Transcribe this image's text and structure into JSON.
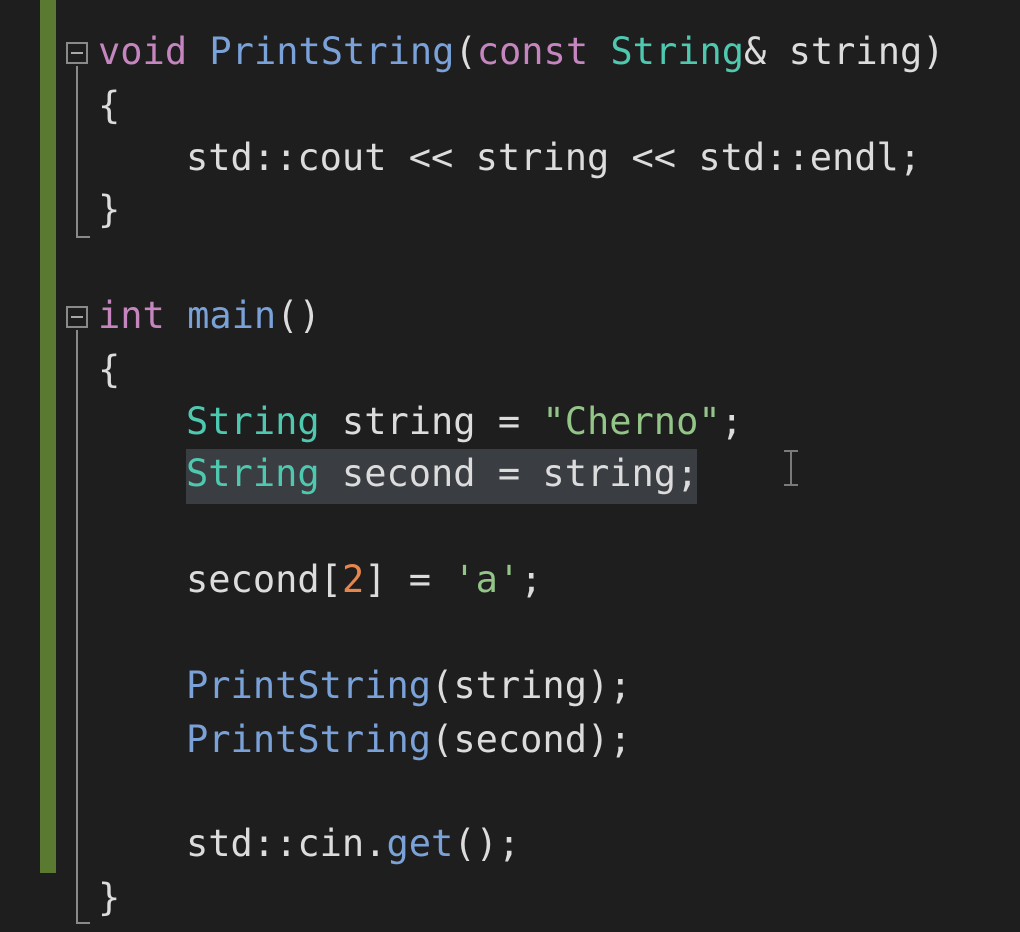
{
  "code": {
    "func_decl": {
      "ret_kw": "void",
      "name": "PrintString",
      "open_paren": "(",
      "const_kw": "const",
      "param_type": "String",
      "param_rest": "& string)"
    },
    "func_open_brace": "{",
    "func_body": {
      "text": "std::cout << string << std::endl;"
    },
    "func_close_brace": "}",
    "main_decl": {
      "ret_kw": "int",
      "name": "main",
      "parens": "()"
    },
    "main_open_brace": "{",
    "line_string_decl": {
      "type": "String",
      "rest": " string = ",
      "literal": "\"Cherno\"",
      "end": ";"
    },
    "line_second_decl": {
      "type": "String",
      "rest": " second = string;"
    },
    "line_index_assign": {
      "start": "second[",
      "index": "2",
      "mid": "] = ",
      "char_literal": "'a'",
      "end": ";"
    },
    "line_print1": {
      "fn": "PrintString",
      "args": "(string);"
    },
    "line_print2": {
      "fn": "PrintString",
      "args": "(second);"
    },
    "line_cin": {
      "prefix": "std::cin.",
      "fn": "get",
      "rest": "();"
    },
    "main_close_brace": "}"
  },
  "colors": {
    "background": "#1e1e1e",
    "keyword": "#c586c0",
    "type": "#4ec9b0",
    "function": "#7aa2d8",
    "string": "#92c587",
    "number": "#e5864d",
    "change_bar": "#5a7a32",
    "selection": "#3a3d41"
  }
}
